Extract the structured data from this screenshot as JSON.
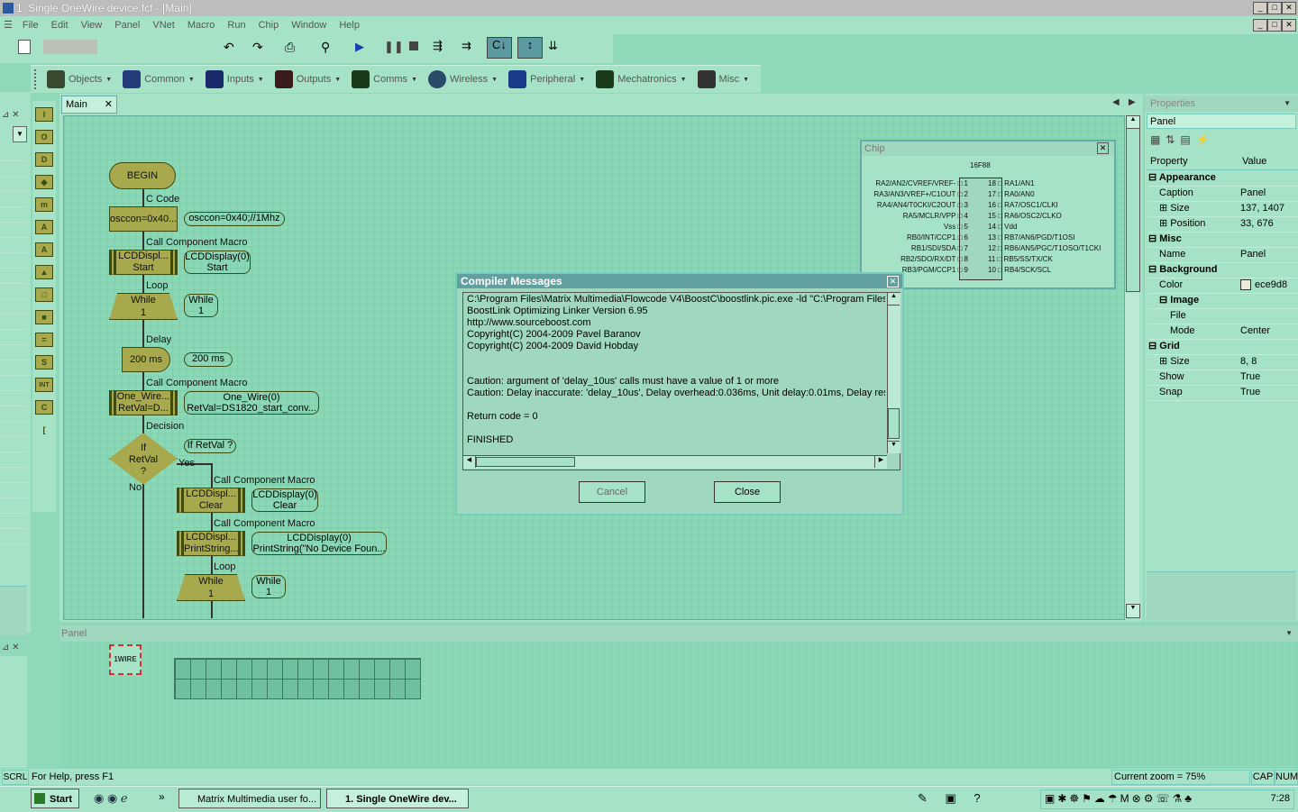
{
  "window": {
    "title": "1. Single OneWire device.fcf - [Main]"
  },
  "menu": [
    "File",
    "Edit",
    "View",
    "Panel",
    "VNet",
    "Macro",
    "Run",
    "Chip",
    "Window",
    "Help"
  ],
  "components_toolbar": [
    "Objects",
    "Common",
    "Inputs",
    "Outputs",
    "Comms",
    "Wireless",
    "Peripheral",
    "Mechatronics",
    "Misc"
  ],
  "tool_icons": [
    "I",
    "O",
    "D",
    "◆",
    "m",
    "A",
    "A",
    "▲",
    "□",
    "■",
    "=",
    "S",
    "INT",
    "C",
    "["
  ],
  "main_tab": "Main",
  "flowchart": {
    "begin": "BEGIN",
    "ccode_label": "C Code",
    "ccode_text": "osccon=0x40...",
    "ccode_bubble": "osccon=0x40;//1Mhz",
    "ccm1_label": "Call Component Macro",
    "ccm1_text1": "LCDDispl...",
    "ccm1_text2": "Start",
    "ccm1_b1": "LCDDisplay(0)",
    "ccm1_b2": "Start",
    "loop1_label": "Loop",
    "loop1_t1": "While",
    "loop1_t2": "1",
    "loop1_b1": "While",
    "loop1_b2": "1",
    "delay_label": "Delay",
    "delay_text": "200 ms",
    "delay_bubble": "200 ms",
    "ccm2_label": "Call Component Macro",
    "ccm2_t1": "One_Wire...",
    "ccm2_t2": "RetVal=D...",
    "ccm2_b1": "One_Wire(0)",
    "ccm2_b2": "RetVal=DS1820_start_conv...",
    "decision_label": "Decision",
    "decision_t1": "If",
    "decision_t2": "RetVal",
    "decision_t3": "?",
    "decision_bubble": "If RetVal ?",
    "yes": "Yes",
    "no": "No",
    "ccm3_label": "Call Component Macro",
    "ccm3_t1": "LCDDispl...",
    "ccm3_t2": "Clear",
    "ccm3_b1": "LCDDisplay(0)",
    "ccm3_b2": "Clear",
    "ccm4_label": "Call Component Macro",
    "ccm4_t1": "LCDDispl...",
    "ccm4_t2": "PrintString...",
    "ccm4_b1": "LCDDisplay(0)",
    "ccm4_b2": "PrintString(\"No Device Foun...",
    "loop2_label": "Loop",
    "loop2_t1": "While",
    "loop2_t2": "1",
    "loop2_b1": "While",
    "loop2_b2": "1"
  },
  "chip": {
    "title": "Chip",
    "part": "16F88",
    "left_pins": [
      "RA2/AN2/CVREF/VREF-",
      "RA3/AN3/VREF+/C1OUT",
      "RA4/AN4/T0CKI/C2OUT",
      "RA5/MCLR/VPP",
      "Vss",
      "RB0/INT/CCP1",
      "RB1/SDI/SDA",
      "RB2/SDO/RX/DT",
      "RB3/PGM/CCP1"
    ],
    "left_nums": [
      "1",
      "2",
      "3",
      "4",
      "5",
      "6",
      "7",
      "8",
      "9"
    ],
    "right_pins": [
      "RA1/AN1",
      "RA0/AN0",
      "RA7/OSC1/CLKI",
      "RA6/OSC2/CLKO",
      "Vdd",
      "RB7/AN6/PGD/T1OSI",
      "RB6/AN5/PGC/T1OSO/T1CKI",
      "RB5/SS/TX/CK",
      "RB4/SCK/SCL"
    ],
    "right_nums": [
      "18",
      "17",
      "16",
      "15",
      "14",
      "13",
      "12",
      "11",
      "10"
    ]
  },
  "compiler": {
    "title": "Compiler Messages",
    "lines": [
      "C:\\Program Files\\Matrix Multimedia\\Flowcode V4\\BoostC\\boostlink.pic.exe -ld \"C:\\Program Files\\M",
      "BoostLink Optimizing Linker Version 6.95",
      "http://www.sourceboost.com",
      "Copyright(C) 2004-2009 Pavel Baranov",
      "Copyright(C) 2004-2009 David Hobday",
      "",
      "",
      "Caution: argument of 'delay_10us' calls must have a value of 1 or more",
      "Caution: Delay inaccurate: 'delay_10us', Delay overhead:0.036ms, Unit delay:0.01ms, Delay resolu",
      "",
      "Return code = 0",
      "",
      "FINISHED"
    ],
    "cancel": "Cancel",
    "close": "Close"
  },
  "properties": {
    "title": "Properties",
    "object": "Panel",
    "col_property": "Property",
    "col_value": "Value",
    "rows": [
      {
        "k": "Appearance",
        "v": "",
        "bold": true,
        "sign": "⊟",
        "indent": 0
      },
      {
        "k": "Caption",
        "v": "Panel",
        "sign": "",
        "indent": 1
      },
      {
        "k": "Size",
        "v": "137, 1407",
        "sign": "⊞",
        "indent": 1
      },
      {
        "k": "Position",
        "v": "33, 676",
        "sign": "⊞",
        "indent": 1
      },
      {
        "k": "Misc",
        "v": "",
        "bold": true,
        "sign": "⊟",
        "indent": 0
      },
      {
        "k": "Name",
        "v": "Panel",
        "sign": "",
        "indent": 1
      },
      {
        "k": "Background",
        "v": "",
        "bold": true,
        "sign": "⊟",
        "indent": 0
      },
      {
        "k": "Color",
        "v": "ece9d8",
        "sign": "",
        "indent": 1
      },
      {
        "k": "Image",
        "v": "",
        "bold": true,
        "sign": "⊟",
        "indent": 1
      },
      {
        "k": "File",
        "v": "",
        "sign": "",
        "indent": 2
      },
      {
        "k": "Mode",
        "v": "Center",
        "sign": "",
        "indent": 2
      },
      {
        "k": "Grid",
        "v": "",
        "bold": true,
        "sign": "⊟",
        "indent": 0
      },
      {
        "k": "Size",
        "v": "8, 8",
        "sign": "⊞",
        "indent": 1
      },
      {
        "k": "Show",
        "v": "True",
        "sign": "",
        "indent": 1
      },
      {
        "k": "Snap",
        "v": "True",
        "sign": "",
        "indent": 1
      }
    ]
  },
  "panel": {
    "title": "Panel",
    "onewire_label": "1WIRE"
  },
  "status": {
    "help": "For Help, press F1",
    "zoom": "Current zoom = 75%",
    "cap": "CAP",
    "num": "NUM",
    "scrl": "SCRL"
  },
  "taskbar": {
    "start": "Start",
    "task1": "Matrix Multimedia user fo...",
    "task2": "1. Single OneWire dev...",
    "clock": "7:28",
    "more": "»"
  }
}
